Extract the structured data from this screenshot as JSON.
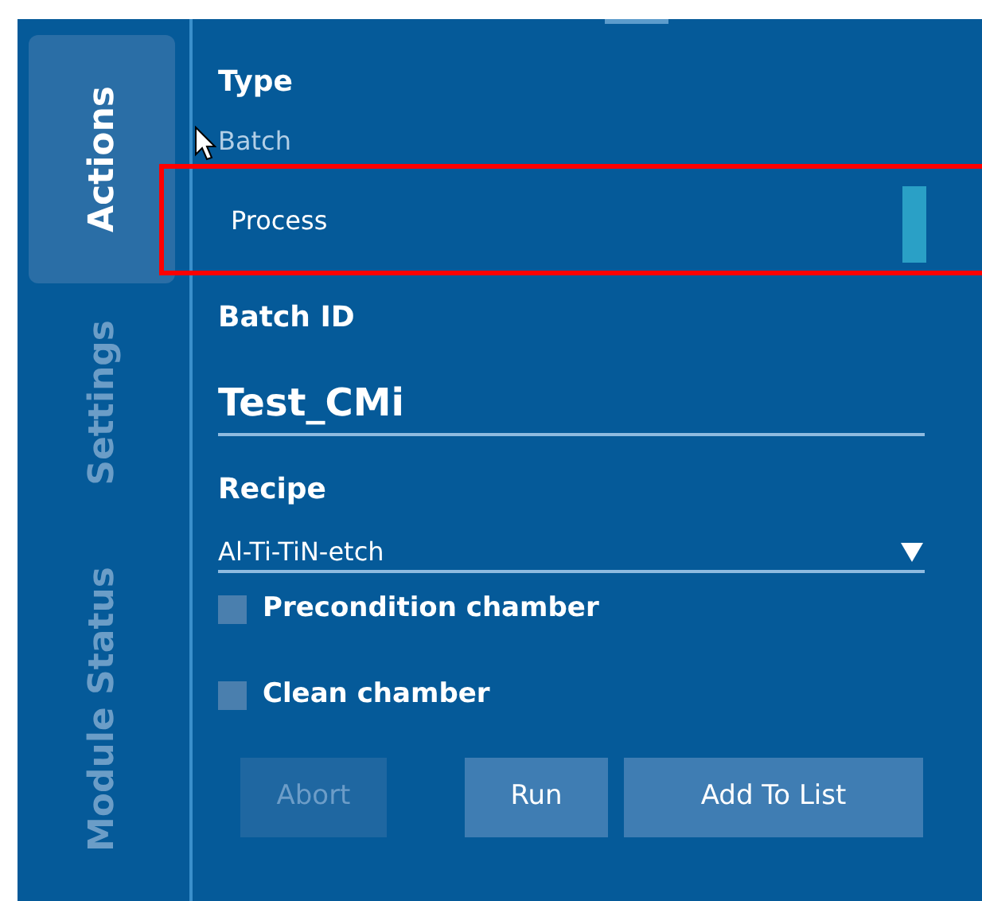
{
  "tabs": [
    {
      "label": "Actions",
      "selected": true
    },
    {
      "label": "Settings",
      "selected": false
    },
    {
      "label": "Module Status",
      "selected": false
    }
  ],
  "type": {
    "label": "Type",
    "options": [
      {
        "label": "Batch",
        "selected": false
      },
      {
        "label": "Process",
        "selected": true
      }
    ]
  },
  "batch_id": {
    "label": "Batch ID",
    "value": "Test_CMi"
  },
  "recipe": {
    "label": "Recipe",
    "value": "Al-Ti-TiN-etch"
  },
  "options": [
    {
      "label": "Precondition chamber",
      "checked": false
    },
    {
      "label": "Clean chamber",
      "checked": false
    }
  ],
  "buttons": [
    {
      "label": "Abort",
      "disabled": true
    },
    {
      "label": "Run",
      "disabled": false
    },
    {
      "label": "Add To List",
      "disabled": false
    }
  ]
}
